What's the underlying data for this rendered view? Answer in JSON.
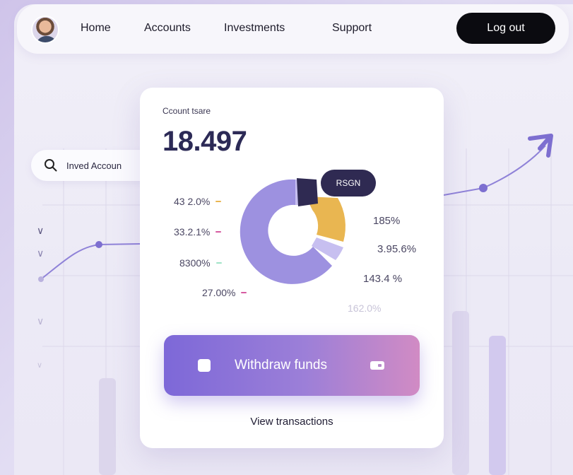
{
  "nav": {
    "links": [
      "Home",
      "Accounts",
      "Investments",
      "Support"
    ],
    "logout_label": "Log out"
  },
  "search": {
    "text": "Inved Accoun"
  },
  "card": {
    "label": "Ccount tsare",
    "value": "18.497",
    "tag": "RSGN",
    "legend_left": [
      {
        "text": "43 2.0%",
        "color": "#e9b651"
      },
      {
        "text": "33.2.1%",
        "color": "#d65aa0"
      },
      {
        "text": "8300%",
        "color": "#9fe3c6"
      },
      {
        "text": "27.00%",
        "color": "#d65aa0"
      }
    ],
    "legend_right": [
      "185%",
      "3.95.6%",
      "143.4 %",
      "162.0%"
    ],
    "withdraw_label": "Withdraw funds",
    "view_transactions": "View transactions"
  },
  "colors": {
    "donut_purple": "#9d91e0",
    "donut_light": "#c7bff0",
    "donut_orange": "#e9b651",
    "donut_navy": "#2f2a52",
    "accent": "#7d68d8"
  }
}
